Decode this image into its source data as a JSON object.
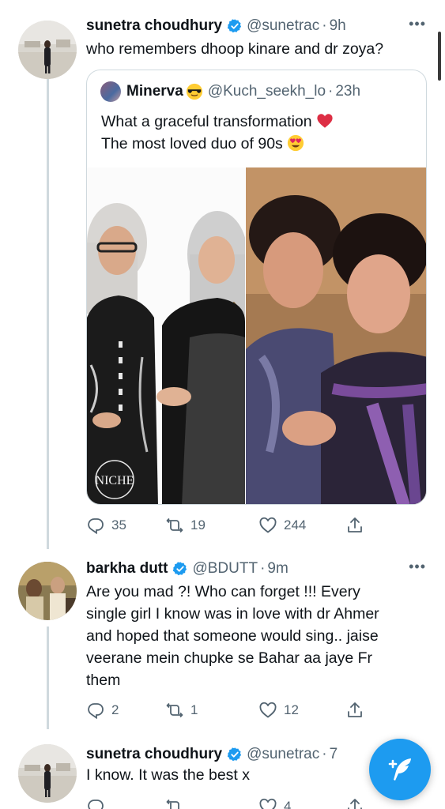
{
  "colors": {
    "accent": "#1d9bf0",
    "muted": "#536471",
    "heart": "#e0245e"
  },
  "tweets": [
    {
      "name": "sunetra choudhury",
      "handle": "@sunetrac",
      "dot": "·",
      "time": "9h",
      "text": "who remembers dhoop kinare and dr zoya?",
      "quote": {
        "name": "Minerva",
        "handle": "@Kuch_seekh_lo",
        "dot": "·",
        "time": "23h",
        "line1": "What a graceful transformation",
        "line2": "The most loved duo of 90s",
        "watermark": "NICHE"
      },
      "replies": "35",
      "retweets": "19",
      "likes": "244"
    },
    {
      "name": "barkha dutt",
      "handle": "@BDUTT",
      "dot": "·",
      "time": "9m",
      "text_lines": [
        "Are you mad ?! Who can forget !!! Every",
        "single girl I know was in love with dr Ahmer",
        "and hoped that someone would sing.. jaise",
        "veerane mein chupke se Bahar aa jaye Fr",
        "them"
      ],
      "replies": "2",
      "retweets": "1",
      "likes": "12"
    },
    {
      "name": "sunetra choudhury",
      "handle": "@sunetrac",
      "dot": "·",
      "time": "7",
      "text": "I know. It was the best x",
      "likes": "4"
    }
  ],
  "icons": {
    "verified": "verified-badge-icon",
    "more": "more-icon",
    "reply": "reply-icon",
    "retweet": "retweet-icon",
    "like": "heart-icon",
    "share": "share-icon",
    "compose": "compose-tweet-icon"
  },
  "more_glyph": "•••"
}
